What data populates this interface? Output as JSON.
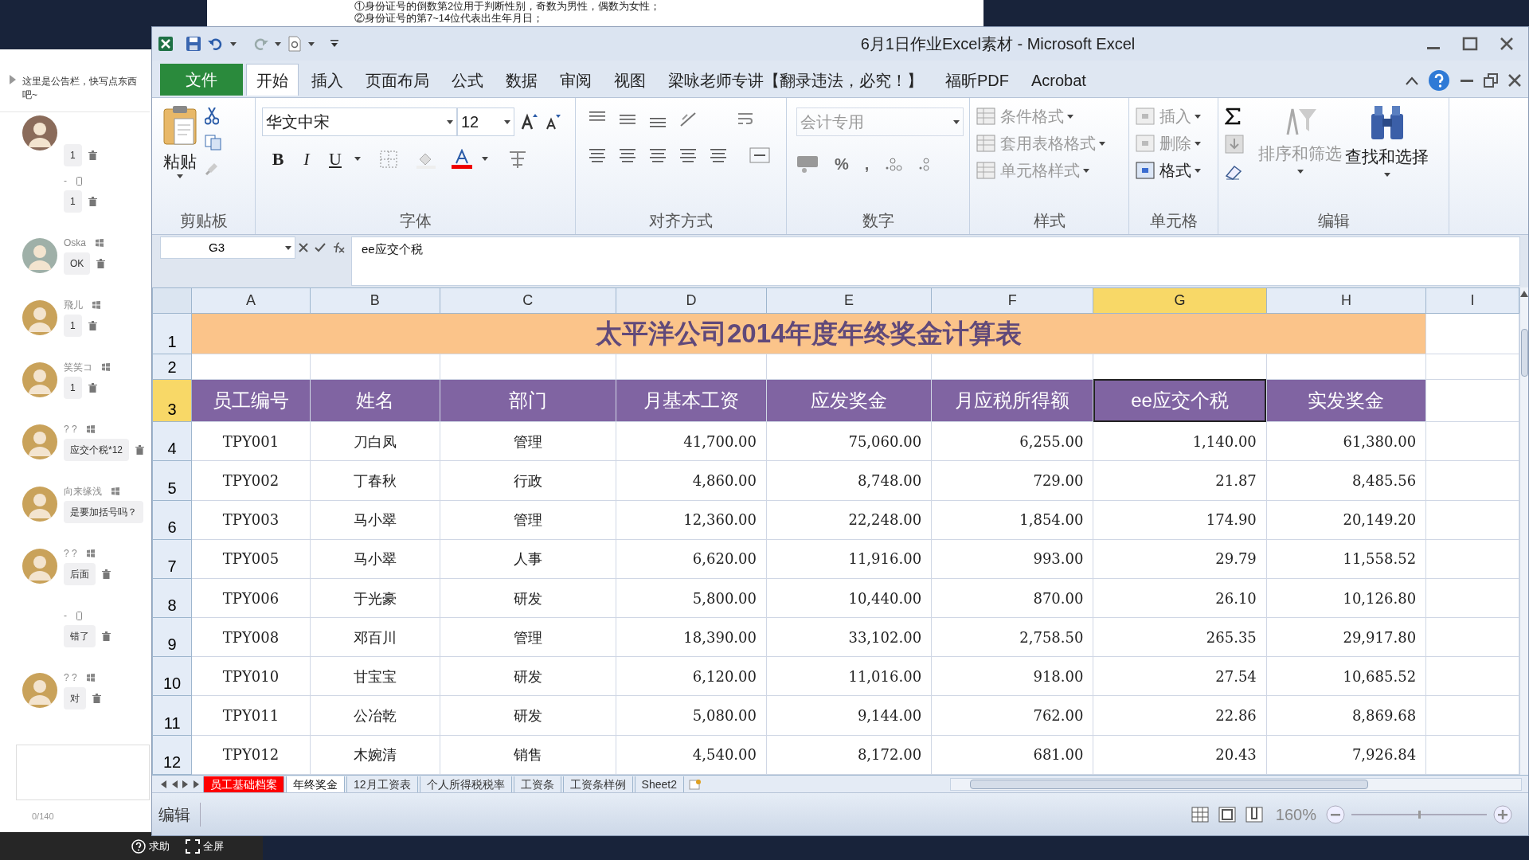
{
  "document_fragment": {
    "lines": [
      "①身份证号的倒数第2位用于判断性别，奇数为男性，偶数为女性；",
      "②身份证号的第7~14位代表出生年月日；"
    ]
  },
  "chat_panel": {
    "notice": "这里是公告栏，快写点东西吧~",
    "messages": [
      {
        "text": "1",
        "avatar": true
      },
      {
        "name": "-",
        "kind": "phone",
        "text": "1",
        "avatar": false
      },
      {
        "name": "Oska",
        "kind": "windows",
        "text": "OK",
        "avatar": true
      },
      {
        "name": "飛儿",
        "kind": "windows",
        "text": "1",
        "avatar": true
      },
      {
        "name": "笑笑コ",
        "kind": "windows",
        "text": "1",
        "avatar": true
      },
      {
        "name": "? ?",
        "kind": "windows",
        "text": "应交个税*12",
        "avatar": true
      },
      {
        "name": "向来缘浅",
        "kind": "windows",
        "text": "是要加括号吗？",
        "avatar": true
      },
      {
        "name": "? ?",
        "kind": "windows",
        "text": "后面",
        "avatar": true
      },
      {
        "name": "-",
        "kind": "phone",
        "text": "错了",
        "avatar": false
      },
      {
        "name": "? ?",
        "kind": "windows",
        "text": "对",
        "avatar": true
      }
    ],
    "counter": "0/140",
    "footer": [
      "求助",
      "全屏"
    ]
  },
  "window": {
    "title": "6月1日作业Excel素材 - Microsoft Excel"
  },
  "ribbon_tabs": [
    {
      "label": "文件",
      "kind": "file",
      "selected": false
    },
    {
      "label": "开始",
      "kind": "tab",
      "selected": true
    },
    {
      "label": "插入",
      "kind": "tab",
      "selected": false
    },
    {
      "label": "页面布局",
      "kind": "tab",
      "selected": false
    },
    {
      "label": "公式",
      "kind": "tab",
      "selected": false
    },
    {
      "label": "数据",
      "kind": "tab",
      "selected": false
    },
    {
      "label": "审阅",
      "kind": "tab",
      "selected": false
    },
    {
      "label": "视图",
      "kind": "tab",
      "selected": false
    },
    {
      "label": "梁咏老师专讲【翻录违法，必究！】",
      "kind": "tab",
      "selected": false
    },
    {
      "label": "福昕PDF",
      "kind": "tab",
      "selected": false
    },
    {
      "label": "Acrobat",
      "kind": "tab",
      "selected": false
    }
  ],
  "ribbon": {
    "clipboard": {
      "paste": "粘贴",
      "label": "剪贴板"
    },
    "font": {
      "name": "华文中宋",
      "size": "12",
      "buttons": [
        "B",
        "I",
        "U"
      ],
      "label": "字体"
    },
    "alignment": {
      "label": "对齐方式"
    },
    "number": {
      "format": "会计专用",
      "disabled": true,
      "buttons": [
        "%",
        ","
      ],
      "label": "数字"
    },
    "styles": {
      "commands": [
        {
          "label": "条件格式",
          "disabled": true
        },
        {
          "label": "套用表格格式",
          "disabled": true
        },
        {
          "label": "单元格样式",
          "disabled": true
        }
      ],
      "label": "样式"
    },
    "cells": {
      "commands": [
        {
          "label": "插入",
          "disabled": true
        },
        {
          "label": "删除",
          "disabled": true
        },
        {
          "label": "格式",
          "disabled": false
        }
      ],
      "label": "单元格"
    },
    "editing": {
      "commands": [
        {
          "label": "排序和筛选",
          "disabled": true
        },
        {
          "label": "查找和选择",
          "disabled": false
        }
      ],
      "label": "编辑"
    }
  },
  "formula_bar": {
    "name_box": "G3",
    "content": "ee应交个税"
  },
  "sheet": {
    "columns": [
      {
        "label": "A",
        "selected": false
      },
      {
        "label": "B",
        "selected": false
      },
      {
        "label": "C",
        "selected": false
      },
      {
        "label": "D",
        "selected": false
      },
      {
        "label": "E",
        "selected": false
      },
      {
        "label": "F",
        "selected": false
      },
      {
        "label": "G",
        "selected": true
      },
      {
        "label": "H",
        "selected": false
      },
      {
        "label": "I",
        "selected": false
      }
    ],
    "row_labels": [
      "1",
      "2",
      "3",
      "4",
      "5",
      "6",
      "7",
      "8",
      "9",
      "10",
      "11",
      "12"
    ],
    "title": "太平洋公司2014年度年终奖金计算表",
    "headers": [
      "员工编号",
      "姓名",
      "部门",
      "月基本工资",
      "应发奖金",
      "月应税所得额",
      "ee应交个税",
      "实发奖金"
    ],
    "rows": [
      [
        "TPY001",
        "刀白凤",
        "管理",
        "41,700.00",
        "75,060.00",
        "6,255.00",
        "1,140.00",
        "61,380.00"
      ],
      [
        "TPY002",
        "丁春秋",
        "行政",
        "4,860.00",
        "8,748.00",
        "729.00",
        "21.87",
        "8,485.56"
      ],
      [
        "TPY003",
        "马小翠",
        "管理",
        "12,360.00",
        "22,248.00",
        "1,854.00",
        "174.90",
        "20,149.20"
      ],
      [
        "TPY005",
        "马小翠",
        "人事",
        "6,620.00",
        "11,916.00",
        "993.00",
        "29.79",
        "11,558.52"
      ],
      [
        "TPY006",
        "于光豪",
        "研发",
        "5,800.00",
        "10,440.00",
        "870.00",
        "26.10",
        "10,126.80"
      ],
      [
        "TPY008",
        "邓百川",
        "管理",
        "18,390.00",
        "33,102.00",
        "2,758.50",
        "265.35",
        "29,917.80"
      ],
      [
        "TPY010",
        "甘宝宝",
        "研发",
        "6,120.00",
        "11,016.00",
        "918.00",
        "27.54",
        "10,685.52"
      ],
      [
        "TPY011",
        "公冶乾",
        "研发",
        "5,080.00",
        "9,144.00",
        "762.00",
        "22.86",
        "8,869.68"
      ],
      [
        "TPY012",
        "木婉清",
        "销售",
        "4,540.00",
        "8,172.00",
        "681.00",
        "20.43",
        "7,926.84"
      ]
    ]
  },
  "sheet_tabs": [
    {
      "label": "员工基础档案",
      "selected": false,
      "color": "#ff0000"
    },
    {
      "label": "年终奖金",
      "selected": true
    },
    {
      "label": "12月工资表",
      "selected": false
    },
    {
      "label": "个人所得税税率",
      "selected": false
    },
    {
      "label": "工资条",
      "selected": false
    },
    {
      "label": "工资条样例",
      "selected": false
    },
    {
      "label": "Sheet2",
      "selected": false
    }
  ],
  "status_bar": {
    "mode": "编辑",
    "zoom": "160%",
    "zoom_slider": {
      "level": 0.5
    }
  }
}
